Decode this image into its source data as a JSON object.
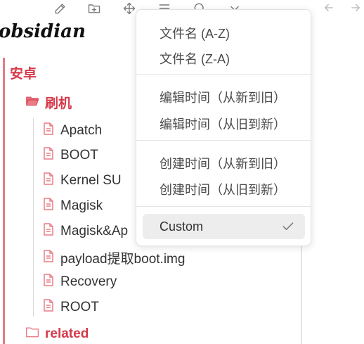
{
  "vault": {
    "name": "obsidian"
  },
  "toolbar": {
    "icons": [
      "edit-icon",
      "new-folder-icon",
      "move-icon",
      "sort-icon",
      "search-icon",
      "chevron-down-icon"
    ],
    "nav": [
      "arrow-left-icon",
      "arrow-right-icon"
    ]
  },
  "tree": {
    "root_folder": "安卓",
    "sub_folder": "刷机",
    "files": [
      "Apatch",
      "BOOT",
      "Kernel SU",
      "Magisk",
      "Magisk&Ap",
      "payload提取boot.img",
      "Recovery",
      "ROOT"
    ],
    "related_folder": "related"
  },
  "sort_menu": {
    "groups": [
      [
        "文件名 (A-Z)",
        "文件名 (Z-A)"
      ],
      [
        "编辑时间（从新到旧）",
        "编辑时间（从旧到新）"
      ],
      [
        "创建时间（从新到旧）",
        "创建时间（从旧到新）"
      ]
    ],
    "selected": "Custom"
  },
  "colors": {
    "accent": "#d63a4a",
    "file_icon": "#ea7c86",
    "tree_line": "#e57b85"
  }
}
